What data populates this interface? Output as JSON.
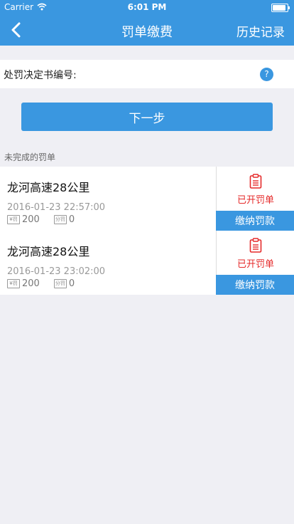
{
  "status_bar": {
    "carrier": "Carrier",
    "time": "6:01 PM",
    "battery_level": 0.9
  },
  "nav": {
    "title": "罚单缴费",
    "right_action": "历史记录",
    "back_icon": "chevron-left-icon"
  },
  "form": {
    "label": "处罚决定书编号:",
    "help_symbol": "?"
  },
  "next_button": "下一步",
  "section_title": "未完成的罚单",
  "tickets": [
    {
      "location": "龙河高速28公里",
      "datetime": "2016-01-23 22:57:00",
      "amount_tag": "¥罚",
      "amount": "200",
      "points_tag": "分罚",
      "points": "0",
      "status": "已开罚单",
      "pay_label": "缴纳罚款"
    },
    {
      "location": "龙河高速28公里",
      "datetime": "2016-01-23 23:02:00",
      "amount_tag": "¥罚",
      "amount": "200",
      "points_tag": "分罚",
      "points": "0",
      "status": "已开罚单",
      "pay_label": "缴纳罚款"
    }
  ],
  "colors": {
    "primary": "#3a97e0",
    "status_red": "#e52a2a",
    "background": "#efeff4"
  }
}
